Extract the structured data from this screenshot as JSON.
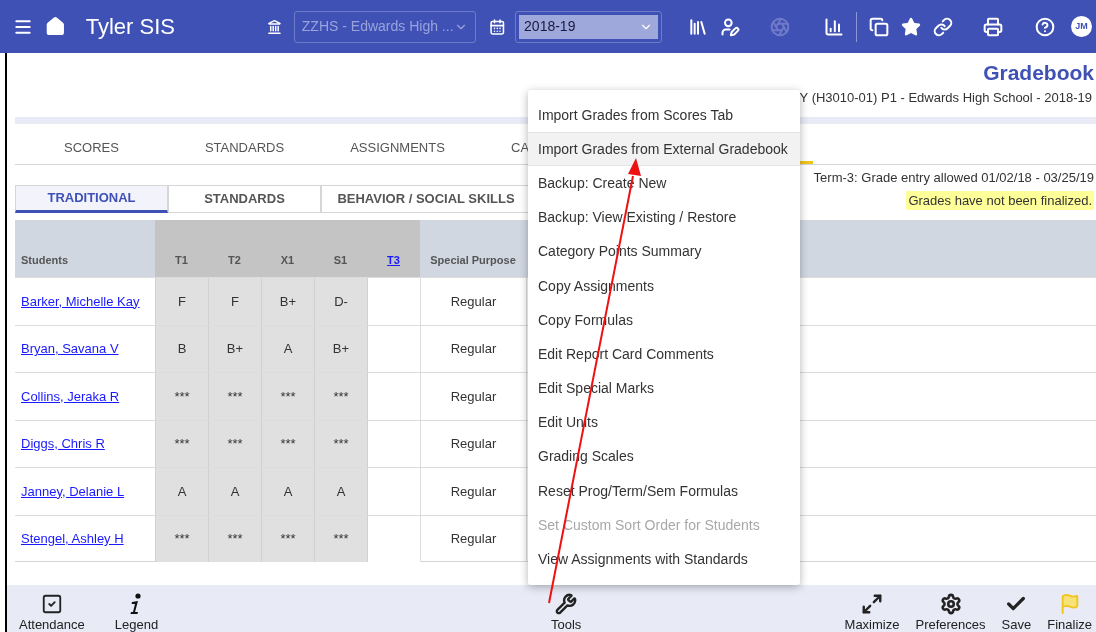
{
  "header": {
    "title": "Tyler SIS",
    "school_select": {
      "value": "ZZHS - Edwards High ...",
      "disabled": true
    },
    "year_select": {
      "value": "2018-19"
    },
    "avatar": "JM"
  },
  "page": {
    "title": "Gradebook",
    "subtitle": "Y (H3010-01) P1 - Edwards High School - 2018-19",
    "term_note": "Term-3: Grade entry allowed 01/02/18 - 03/25/19",
    "finalize_notice": "Grades have not been finalized."
  },
  "tabs": [
    {
      "label": "SCORES",
      "selected": false
    },
    {
      "label": "STANDARDS",
      "selected": false
    },
    {
      "label": "ASSIGNMENTS",
      "selected": false
    },
    {
      "label": "CA",
      "selected": false
    },
    {
      "selected": true
    }
  ],
  "sub_tabs": [
    {
      "label": "TRADITIONAL",
      "selected": true
    },
    {
      "label": "STANDARDS",
      "selected": false
    },
    {
      "label": "BEHAVIOR / SOCIAL SKILLS",
      "selected": false
    }
  ],
  "table": {
    "columns": [
      {
        "label": "Students",
        "kind": "name"
      },
      {
        "label": "T1",
        "kind": "grade"
      },
      {
        "label": "T2",
        "kind": "grade"
      },
      {
        "label": "X1",
        "kind": "grade"
      },
      {
        "label": "S1",
        "kind": "grade"
      },
      {
        "label": "T3",
        "kind": "link"
      },
      {
        "label": "Special Purpose",
        "kind": "text"
      }
    ],
    "rows": [
      {
        "student": "Barker, Michelle Kay",
        "marks": [
          "F",
          "F",
          "B+",
          "D-"
        ],
        "special_purpose": "Regular"
      },
      {
        "student": "Bryan, Savana V",
        "marks": [
          "B",
          "B+",
          "A",
          "B+"
        ],
        "special_purpose": "Regular"
      },
      {
        "student": "Collins, Jeraka R",
        "marks": [
          "***",
          "***",
          "***",
          "***"
        ],
        "special_purpose": "Regular"
      },
      {
        "student": "Diggs, Chris R",
        "marks": [
          "***",
          "***",
          "***",
          "***"
        ],
        "special_purpose": "Regular"
      },
      {
        "student": "Janney, Delanie L",
        "marks": [
          "A",
          "A",
          "A",
          "A"
        ],
        "special_purpose": "Regular"
      },
      {
        "student": "Stengel, Ashley H",
        "marks": [
          "***",
          "***",
          "***",
          "***"
        ],
        "special_purpose": "Regular"
      }
    ]
  },
  "tools_menu": {
    "items": [
      {
        "label": "Import Grades from Scores Tab",
        "highlighted": false,
        "disabled": false
      },
      {
        "label": "Import Grades from External Gradebook",
        "highlighted": true,
        "disabled": false
      },
      {
        "label": "Backup: Create New",
        "highlighted": false,
        "disabled": false
      },
      {
        "label": "Backup: View Existing / Restore",
        "highlighted": false,
        "disabled": false
      },
      {
        "label": "Category Points Summary",
        "highlighted": false,
        "disabled": false
      },
      {
        "label": "Copy Assignments",
        "highlighted": false,
        "disabled": false
      },
      {
        "label": "Copy Formulas",
        "highlighted": false,
        "disabled": false
      },
      {
        "label": "Edit Report Card Comments",
        "highlighted": false,
        "disabled": false
      },
      {
        "label": "Edit Special Marks",
        "highlighted": false,
        "disabled": false
      },
      {
        "label": "Edit Units",
        "highlighted": false,
        "disabled": false
      },
      {
        "label": "Grading Scales",
        "highlighted": false,
        "disabled": false
      },
      {
        "label": "Reset Prog/Term/Sem Formulas",
        "highlighted": false,
        "disabled": false
      },
      {
        "label": "Set Custom Sort Order for Students",
        "highlighted": false,
        "disabled": true
      },
      {
        "label": "View Assignments with Standards",
        "highlighted": false,
        "disabled": false
      }
    ]
  },
  "toolbar": {
    "left": [
      {
        "label": "Attendance",
        "kind": "attendance"
      },
      {
        "label": "Legend",
        "kind": "legend"
      }
    ],
    "center": [
      {
        "label": "Tools",
        "kind": "tools"
      }
    ],
    "right": [
      {
        "label": "Maximize",
        "kind": "maximize"
      },
      {
        "label": "Preferences",
        "kind": "preferences"
      },
      {
        "label": "Save",
        "kind": "save"
      },
      {
        "label": "Finalize",
        "kind": "finalize"
      }
    ]
  }
}
